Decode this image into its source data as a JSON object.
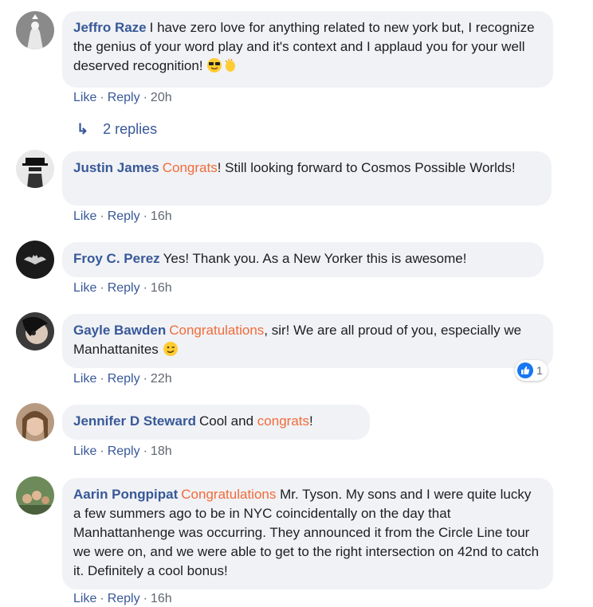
{
  "actions": {
    "like": "Like",
    "reply": "Reply",
    "dot": "·"
  },
  "comments": [
    {
      "author": "Jeffro Raze",
      "text": "I have zero love for anything related to new york but, I recognize the genius of your word play and it's context and I applaud you for your well deserved recognition!",
      "emojis": [
        "sunglasses-emoji",
        "clapping-hands-emoji"
      ],
      "time": "20h"
    },
    {
      "author": "Justin James",
      "highlight": "Congrats",
      "text": "! Still looking forward to Cosmos Possible Worlds!",
      "time": "16h"
    },
    {
      "author": "Froy C. Perez",
      "text": "Yes! Thank you. As a New Yorker this is awesome!",
      "time": "16h"
    },
    {
      "author": "Gayle Bawden",
      "highlight": "Congratulations",
      "text": ", sir! We are all proud of you, especially we Manhattanites",
      "emojis": [
        "winking-face-emoji"
      ],
      "time": "22h",
      "reaction": {
        "icon": "like-reaction-icon",
        "count": "1"
      }
    },
    {
      "author": "Jennifer D Steward",
      "text_before": "Cool and",
      "highlight": "congrats",
      "text": "!",
      "time": "18h"
    },
    {
      "author": "Aarin Pongpipat",
      "highlight": "Congratulations",
      "text": "Mr. Tyson. My sons and I were quite lucky a few summers ago to be in NYC coincidentally on the day that Manhattanhenge was occurring. They announced it from the Circle Line tour we were on, and we were able to get to the right intersection on 42nd to catch it. Definitely a cool bonus!",
      "time": "16h"
    }
  ],
  "replies": {
    "label": "2 replies",
    "icon": "reply-arrow-icon"
  },
  "colors": {
    "link": "#385898",
    "highlight": "#f26b3a",
    "bubble": "#f0f2f5",
    "meta": "#606770"
  }
}
